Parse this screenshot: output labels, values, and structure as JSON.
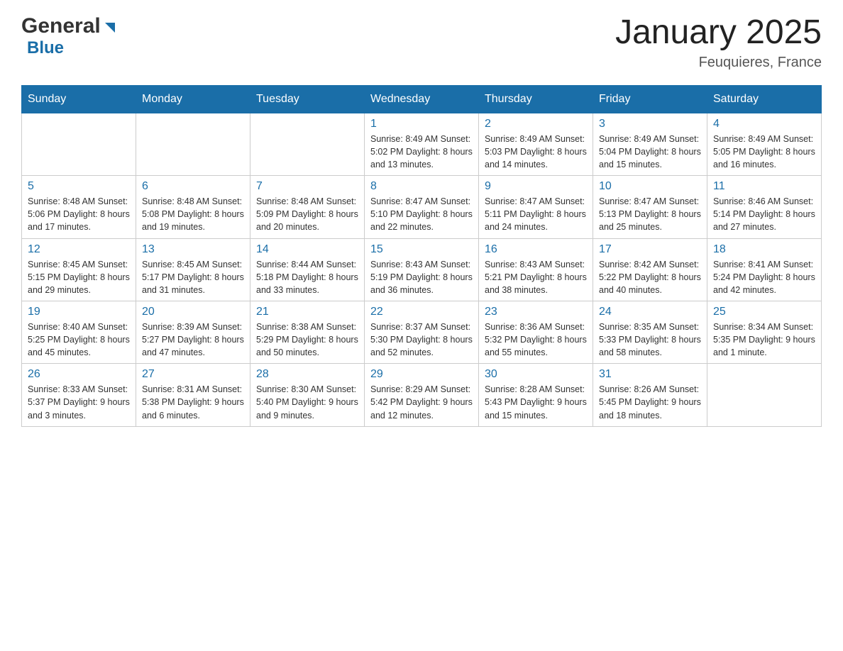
{
  "header": {
    "logo_general": "General",
    "logo_blue": "Blue",
    "title": "January 2025",
    "subtitle": "Feuquieres, France"
  },
  "days_of_week": [
    "Sunday",
    "Monday",
    "Tuesday",
    "Wednesday",
    "Thursday",
    "Friday",
    "Saturday"
  ],
  "weeks": [
    [
      {
        "day": "",
        "info": ""
      },
      {
        "day": "",
        "info": ""
      },
      {
        "day": "",
        "info": ""
      },
      {
        "day": "1",
        "info": "Sunrise: 8:49 AM\nSunset: 5:02 PM\nDaylight: 8 hours\nand 13 minutes."
      },
      {
        "day": "2",
        "info": "Sunrise: 8:49 AM\nSunset: 5:03 PM\nDaylight: 8 hours\nand 14 minutes."
      },
      {
        "day": "3",
        "info": "Sunrise: 8:49 AM\nSunset: 5:04 PM\nDaylight: 8 hours\nand 15 minutes."
      },
      {
        "day": "4",
        "info": "Sunrise: 8:49 AM\nSunset: 5:05 PM\nDaylight: 8 hours\nand 16 minutes."
      }
    ],
    [
      {
        "day": "5",
        "info": "Sunrise: 8:48 AM\nSunset: 5:06 PM\nDaylight: 8 hours\nand 17 minutes."
      },
      {
        "day": "6",
        "info": "Sunrise: 8:48 AM\nSunset: 5:08 PM\nDaylight: 8 hours\nand 19 minutes."
      },
      {
        "day": "7",
        "info": "Sunrise: 8:48 AM\nSunset: 5:09 PM\nDaylight: 8 hours\nand 20 minutes."
      },
      {
        "day": "8",
        "info": "Sunrise: 8:47 AM\nSunset: 5:10 PM\nDaylight: 8 hours\nand 22 minutes."
      },
      {
        "day": "9",
        "info": "Sunrise: 8:47 AM\nSunset: 5:11 PM\nDaylight: 8 hours\nand 24 minutes."
      },
      {
        "day": "10",
        "info": "Sunrise: 8:47 AM\nSunset: 5:13 PM\nDaylight: 8 hours\nand 25 minutes."
      },
      {
        "day": "11",
        "info": "Sunrise: 8:46 AM\nSunset: 5:14 PM\nDaylight: 8 hours\nand 27 minutes."
      }
    ],
    [
      {
        "day": "12",
        "info": "Sunrise: 8:45 AM\nSunset: 5:15 PM\nDaylight: 8 hours\nand 29 minutes."
      },
      {
        "day": "13",
        "info": "Sunrise: 8:45 AM\nSunset: 5:17 PM\nDaylight: 8 hours\nand 31 minutes."
      },
      {
        "day": "14",
        "info": "Sunrise: 8:44 AM\nSunset: 5:18 PM\nDaylight: 8 hours\nand 33 minutes."
      },
      {
        "day": "15",
        "info": "Sunrise: 8:43 AM\nSunset: 5:19 PM\nDaylight: 8 hours\nand 36 minutes."
      },
      {
        "day": "16",
        "info": "Sunrise: 8:43 AM\nSunset: 5:21 PM\nDaylight: 8 hours\nand 38 minutes."
      },
      {
        "day": "17",
        "info": "Sunrise: 8:42 AM\nSunset: 5:22 PM\nDaylight: 8 hours\nand 40 minutes."
      },
      {
        "day": "18",
        "info": "Sunrise: 8:41 AM\nSunset: 5:24 PM\nDaylight: 8 hours\nand 42 minutes."
      }
    ],
    [
      {
        "day": "19",
        "info": "Sunrise: 8:40 AM\nSunset: 5:25 PM\nDaylight: 8 hours\nand 45 minutes."
      },
      {
        "day": "20",
        "info": "Sunrise: 8:39 AM\nSunset: 5:27 PM\nDaylight: 8 hours\nand 47 minutes."
      },
      {
        "day": "21",
        "info": "Sunrise: 8:38 AM\nSunset: 5:29 PM\nDaylight: 8 hours\nand 50 minutes."
      },
      {
        "day": "22",
        "info": "Sunrise: 8:37 AM\nSunset: 5:30 PM\nDaylight: 8 hours\nand 52 minutes."
      },
      {
        "day": "23",
        "info": "Sunrise: 8:36 AM\nSunset: 5:32 PM\nDaylight: 8 hours\nand 55 minutes."
      },
      {
        "day": "24",
        "info": "Sunrise: 8:35 AM\nSunset: 5:33 PM\nDaylight: 8 hours\nand 58 minutes."
      },
      {
        "day": "25",
        "info": "Sunrise: 8:34 AM\nSunset: 5:35 PM\nDaylight: 9 hours\nand 1 minute."
      }
    ],
    [
      {
        "day": "26",
        "info": "Sunrise: 8:33 AM\nSunset: 5:37 PM\nDaylight: 9 hours\nand 3 minutes."
      },
      {
        "day": "27",
        "info": "Sunrise: 8:31 AM\nSunset: 5:38 PM\nDaylight: 9 hours\nand 6 minutes."
      },
      {
        "day": "28",
        "info": "Sunrise: 8:30 AM\nSunset: 5:40 PM\nDaylight: 9 hours\nand 9 minutes."
      },
      {
        "day": "29",
        "info": "Sunrise: 8:29 AM\nSunset: 5:42 PM\nDaylight: 9 hours\nand 12 minutes."
      },
      {
        "day": "30",
        "info": "Sunrise: 8:28 AM\nSunset: 5:43 PM\nDaylight: 9 hours\nand 15 minutes."
      },
      {
        "day": "31",
        "info": "Sunrise: 8:26 AM\nSunset: 5:45 PM\nDaylight: 9 hours\nand 18 minutes."
      },
      {
        "day": "",
        "info": ""
      }
    ]
  ]
}
